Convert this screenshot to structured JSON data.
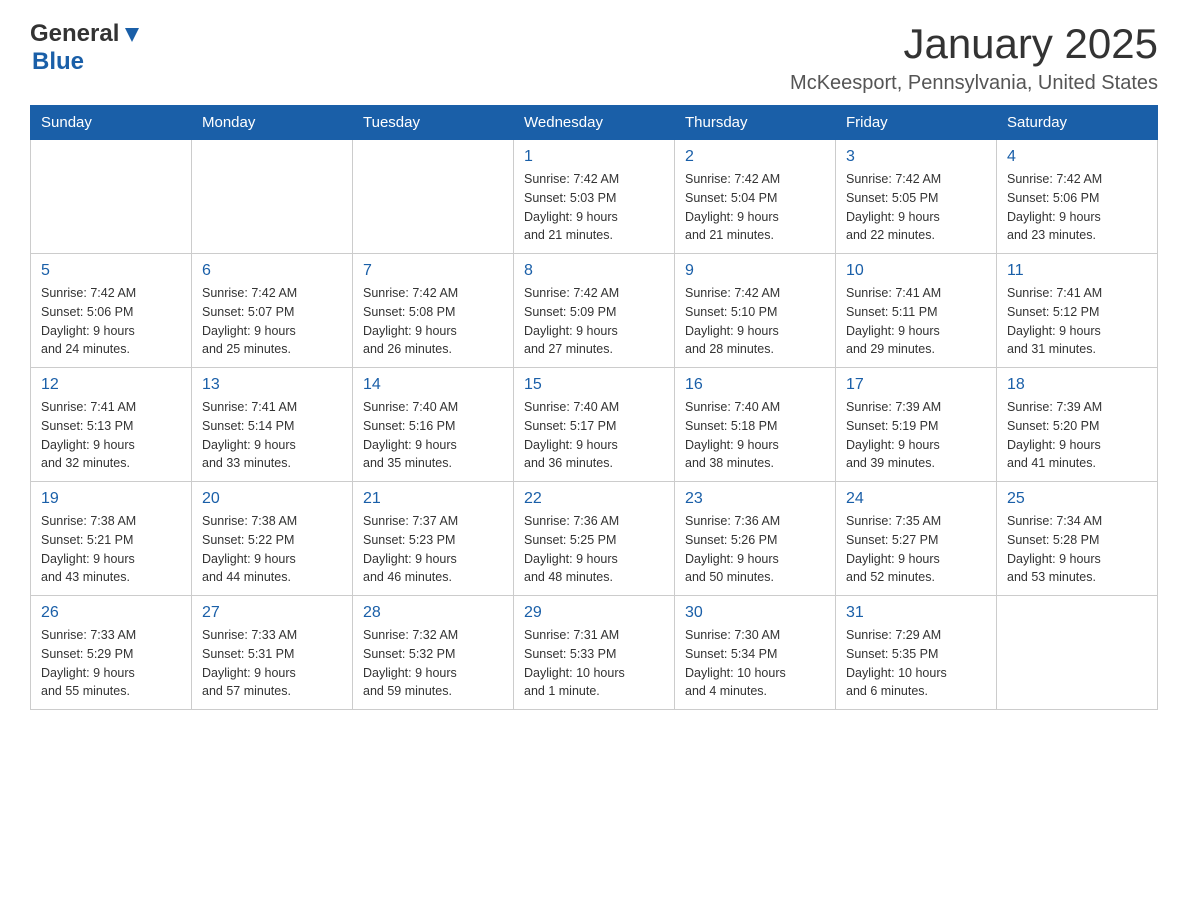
{
  "header": {
    "logo_general": "General",
    "logo_blue": "Blue",
    "month_year": "January 2025",
    "location": "McKeesport, Pennsylvania, United States"
  },
  "weekdays": [
    "Sunday",
    "Monday",
    "Tuesday",
    "Wednesday",
    "Thursday",
    "Friday",
    "Saturday"
  ],
  "weeks": [
    [
      {
        "day": "",
        "info": ""
      },
      {
        "day": "",
        "info": ""
      },
      {
        "day": "",
        "info": ""
      },
      {
        "day": "1",
        "info": "Sunrise: 7:42 AM\nSunset: 5:03 PM\nDaylight: 9 hours\nand 21 minutes."
      },
      {
        "day": "2",
        "info": "Sunrise: 7:42 AM\nSunset: 5:04 PM\nDaylight: 9 hours\nand 21 minutes."
      },
      {
        "day": "3",
        "info": "Sunrise: 7:42 AM\nSunset: 5:05 PM\nDaylight: 9 hours\nand 22 minutes."
      },
      {
        "day": "4",
        "info": "Sunrise: 7:42 AM\nSunset: 5:06 PM\nDaylight: 9 hours\nand 23 minutes."
      }
    ],
    [
      {
        "day": "5",
        "info": "Sunrise: 7:42 AM\nSunset: 5:06 PM\nDaylight: 9 hours\nand 24 minutes."
      },
      {
        "day": "6",
        "info": "Sunrise: 7:42 AM\nSunset: 5:07 PM\nDaylight: 9 hours\nand 25 minutes."
      },
      {
        "day": "7",
        "info": "Sunrise: 7:42 AM\nSunset: 5:08 PM\nDaylight: 9 hours\nand 26 minutes."
      },
      {
        "day": "8",
        "info": "Sunrise: 7:42 AM\nSunset: 5:09 PM\nDaylight: 9 hours\nand 27 minutes."
      },
      {
        "day": "9",
        "info": "Sunrise: 7:42 AM\nSunset: 5:10 PM\nDaylight: 9 hours\nand 28 minutes."
      },
      {
        "day": "10",
        "info": "Sunrise: 7:41 AM\nSunset: 5:11 PM\nDaylight: 9 hours\nand 29 minutes."
      },
      {
        "day": "11",
        "info": "Sunrise: 7:41 AM\nSunset: 5:12 PM\nDaylight: 9 hours\nand 31 minutes."
      }
    ],
    [
      {
        "day": "12",
        "info": "Sunrise: 7:41 AM\nSunset: 5:13 PM\nDaylight: 9 hours\nand 32 minutes."
      },
      {
        "day": "13",
        "info": "Sunrise: 7:41 AM\nSunset: 5:14 PM\nDaylight: 9 hours\nand 33 minutes."
      },
      {
        "day": "14",
        "info": "Sunrise: 7:40 AM\nSunset: 5:16 PM\nDaylight: 9 hours\nand 35 minutes."
      },
      {
        "day": "15",
        "info": "Sunrise: 7:40 AM\nSunset: 5:17 PM\nDaylight: 9 hours\nand 36 minutes."
      },
      {
        "day": "16",
        "info": "Sunrise: 7:40 AM\nSunset: 5:18 PM\nDaylight: 9 hours\nand 38 minutes."
      },
      {
        "day": "17",
        "info": "Sunrise: 7:39 AM\nSunset: 5:19 PM\nDaylight: 9 hours\nand 39 minutes."
      },
      {
        "day": "18",
        "info": "Sunrise: 7:39 AM\nSunset: 5:20 PM\nDaylight: 9 hours\nand 41 minutes."
      }
    ],
    [
      {
        "day": "19",
        "info": "Sunrise: 7:38 AM\nSunset: 5:21 PM\nDaylight: 9 hours\nand 43 minutes."
      },
      {
        "day": "20",
        "info": "Sunrise: 7:38 AM\nSunset: 5:22 PM\nDaylight: 9 hours\nand 44 minutes."
      },
      {
        "day": "21",
        "info": "Sunrise: 7:37 AM\nSunset: 5:23 PM\nDaylight: 9 hours\nand 46 minutes."
      },
      {
        "day": "22",
        "info": "Sunrise: 7:36 AM\nSunset: 5:25 PM\nDaylight: 9 hours\nand 48 minutes."
      },
      {
        "day": "23",
        "info": "Sunrise: 7:36 AM\nSunset: 5:26 PM\nDaylight: 9 hours\nand 50 minutes."
      },
      {
        "day": "24",
        "info": "Sunrise: 7:35 AM\nSunset: 5:27 PM\nDaylight: 9 hours\nand 52 minutes."
      },
      {
        "day": "25",
        "info": "Sunrise: 7:34 AM\nSunset: 5:28 PM\nDaylight: 9 hours\nand 53 minutes."
      }
    ],
    [
      {
        "day": "26",
        "info": "Sunrise: 7:33 AM\nSunset: 5:29 PM\nDaylight: 9 hours\nand 55 minutes."
      },
      {
        "day": "27",
        "info": "Sunrise: 7:33 AM\nSunset: 5:31 PM\nDaylight: 9 hours\nand 57 minutes."
      },
      {
        "day": "28",
        "info": "Sunrise: 7:32 AM\nSunset: 5:32 PM\nDaylight: 9 hours\nand 59 minutes."
      },
      {
        "day": "29",
        "info": "Sunrise: 7:31 AM\nSunset: 5:33 PM\nDaylight: 10 hours\nand 1 minute."
      },
      {
        "day": "30",
        "info": "Sunrise: 7:30 AM\nSunset: 5:34 PM\nDaylight: 10 hours\nand 4 minutes."
      },
      {
        "day": "31",
        "info": "Sunrise: 7:29 AM\nSunset: 5:35 PM\nDaylight: 10 hours\nand 6 minutes."
      },
      {
        "day": "",
        "info": ""
      }
    ]
  ]
}
